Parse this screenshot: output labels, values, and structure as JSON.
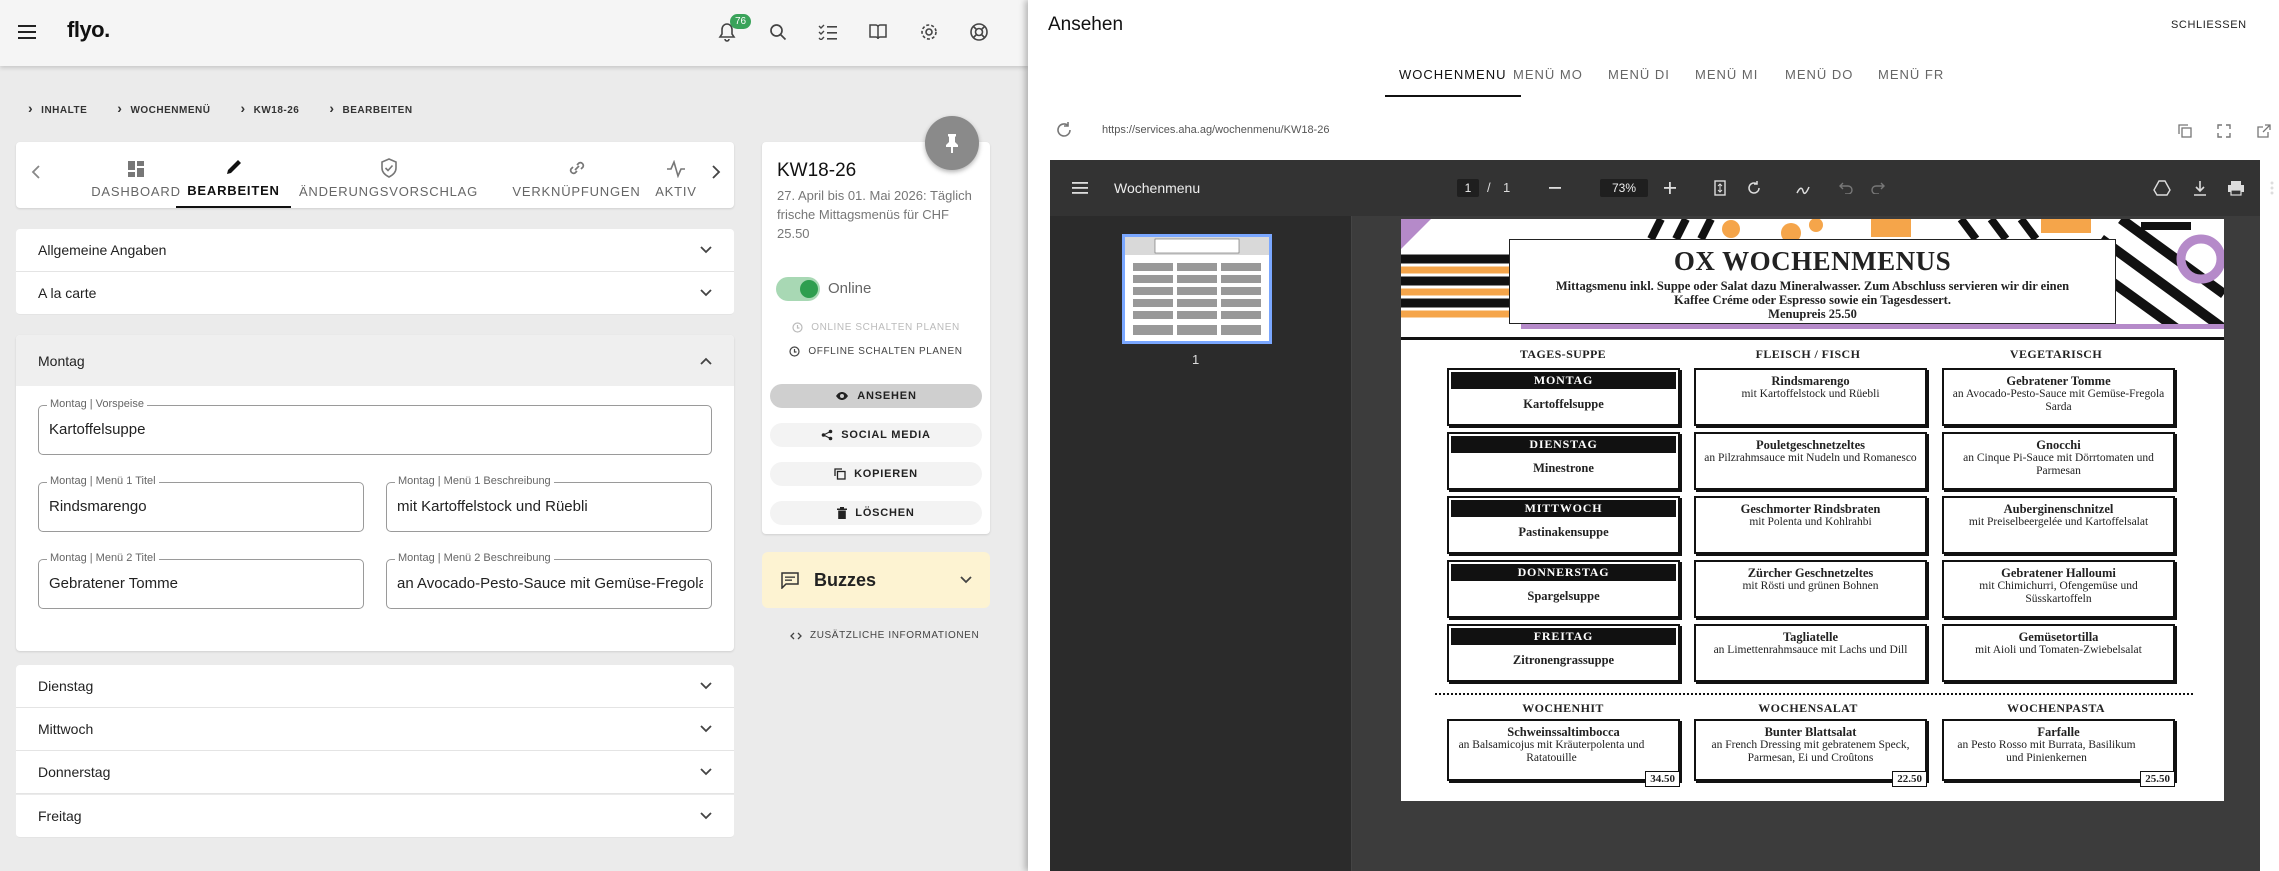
{
  "app": {
    "logo": "flyo.",
    "notifications": "76",
    "breadcrumb": [
      "INHALTE",
      "WOCHENMENÜ",
      "KW18-26",
      "BEARBEITEN"
    ],
    "tabs": [
      "DASHBOARD",
      "BEARBEITEN",
      "ÄNDERUNGSVORSCHLAG",
      "VERKNÜPFUNGEN",
      "AKTIV"
    ],
    "sections": {
      "allgemein": "Allgemeine Angaben",
      "alacarte": "A la carte",
      "montag": "Montag",
      "dienstag": "Dienstag",
      "mittwoch": "Mittwoch",
      "donnerstag": "Donnerstag",
      "freitag": "Freitag"
    },
    "fields": {
      "vorspeise_label": "Montag | Vorspeise",
      "vorspeise_value": "Kartoffelsuppe",
      "m1_title_label": "Montag | Menü 1 Titel",
      "m1_title_value": "Rindsmarengo",
      "m1_desc_label": "Montag | Menü 1 Beschreibung",
      "m1_desc_value": "mit Kartoffelstock und Rüebli",
      "m2_title_label": "Montag | Menü 2 Titel",
      "m2_title_value": "Gebratener Tomme",
      "m2_desc_label": "Montag | Menü 2 Beschreibung",
      "m2_desc_value": "an Avocado-Pesto-Sauce mit Gemüse-Fregola S"
    },
    "info": {
      "title": "KW18-26",
      "description": "27. April bis 01. Mai 2026: Täglich frische Mittagsmenüs für CHF 25.50",
      "status": "Online",
      "schedule_online": "ONLINE SCHALTEN PLANEN",
      "schedule_offline": "OFFLINE SCHALTEN PLANEN",
      "view": "ANSEHEN",
      "social": "SOCIAL MEDIA",
      "copy": "KOPIEREN",
      "delete": "LÖSCHEN"
    },
    "buzzes": "Buzzes",
    "extra_info": "ZUSÄTZLICHE INFORMATIONEN"
  },
  "preview": {
    "title": "Ansehen",
    "close": "SCHLIESSEN",
    "tabs": [
      "WOCHENMENU",
      "MENÜ MO",
      "MENÜ DI",
      "MENÜ MI",
      "MENÜ DO",
      "MENÜ FR"
    ],
    "url": "https://services.aha.ag/wochenmenu/KW18-26",
    "viewer": {
      "title": "Wochenmenu",
      "page": "1",
      "pages": "1",
      "separator": "/",
      "zoom": "73%",
      "thumb_label": "1"
    },
    "doc": {
      "title": "OX WOCHENMENUS",
      "subtitle": "Mittagsmenu inkl. Suppe oder Salat dazu Mineralwasser. Zum Abschluss servieren wir dir einen Kaffee Créme oder Espresso sowie ein Tagesdessert.",
      "price_line": "Menupreis 25.50",
      "col_soup": "TAGES-SUPPE",
      "col_meat": "FLEISCH / FISCH",
      "col_veg": "VEGETARISCH",
      "days": [
        {
          "day": "MONTAG",
          "soup": "Kartoffelsuppe",
          "meat_t": "Rindsmarengo",
          "meat_d": "mit Kartoffelstock und Rüebli",
          "veg_t": "Gebratener Tomme",
          "veg_d": "an Avocado-Pesto-Sauce mit Gemüse-Fregola Sarda"
        },
        {
          "day": "DIENSTAG",
          "soup": "Minestrone",
          "meat_t": "Pouletgeschnetzeltes",
          "meat_d": "an Pilzrahmsauce mit Nudeln und Romanesco",
          "veg_t": "Gnocchi",
          "veg_d": "an Cinque Pi-Sauce mit Dörrtomaten und Parmesan"
        },
        {
          "day": "MITTWOCH",
          "soup": "Pastinakensuppe",
          "meat_t": "Geschmorter Rindsbraten",
          "meat_d": "mit Polenta und Kohlrahbi",
          "veg_t": "Auberginenschnitzel",
          "veg_d": "mit Preiselbeergelée und Kartoffelsalat"
        },
        {
          "day": "DONNERSTAG",
          "soup": "Spargelsuppe",
          "meat_t": "Zürcher Geschnetzeltes",
          "meat_d": "mit Rösti und grünen Bohnen",
          "veg_t": "Gebratener Halloumi",
          "veg_d": "mit Chimichurri, Ofengemüse und Süsskartoffeln"
        },
        {
          "day": "FREITAG",
          "soup": "Zitronengrassuppe",
          "meat_t": "Tagliatelle",
          "meat_d": "an Limettenrahmsauce mit Lachs und Dill",
          "veg_t": "Gemüsetortilla",
          "veg_d": "mit Aioli und Tomaten-Zwiebelsalat"
        }
      ],
      "weekly": [
        {
          "head": "WOCHENHIT",
          "t": "Schweinssaltimbocca",
          "d": "an Balsamicojus mit Kräuterpolenta und Ratatouille",
          "p": "34.50"
        },
        {
          "head": "WOCHENSALAT",
          "t": "Bunter Blattsalat",
          "d": "an French Dressing mit gebratenem Speck, Parmesan, Ei und Croûtons",
          "p": "22.50"
        },
        {
          "head": "WOCHENPASTA",
          "t": "Farfalle",
          "d": "an Pesto Rosso mit Burrata, Basilikum und Pinienkernen",
          "p": "25.50"
        }
      ]
    }
  },
  "colors": {
    "accent": "#2e9e4f",
    "buzz_bg": "#fdf3d2",
    "viewer_bg": "#3c3c3c"
  }
}
